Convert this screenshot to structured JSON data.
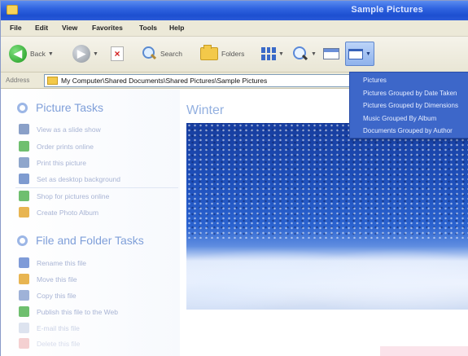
{
  "window": {
    "title": "Sample Pictures"
  },
  "menu": {
    "items": [
      "File",
      "Edit",
      "View",
      "Favorites",
      "Tools",
      "Help"
    ]
  },
  "toolbar": {
    "back_label": "Back",
    "search_label": "Search",
    "folders_label": "Folders"
  },
  "address": {
    "label": "Address",
    "path": "My Computer\\Shared Documents\\Shared Pictures\\Sample Pictures"
  },
  "picture_tasks": {
    "heading": "Picture Tasks",
    "items": [
      {
        "label": "View as a slide show",
        "icon": "slideshow-icon",
        "color": "#8aa0c8"
      },
      {
        "label": "Order prints online",
        "icon": "globe-icon",
        "color": "#6fbf6f"
      },
      {
        "label": "Print this picture",
        "icon": "printer-icon",
        "color": "#8fa6cc"
      },
      {
        "label": "Set as desktop background",
        "icon": "desktop-icon",
        "color": "#7e9bd0"
      },
      {
        "label": "Shop for pictures online",
        "icon": "globe-icon",
        "color": "#6fbf6f"
      },
      {
        "label": "Create Photo Album",
        "icon": "album-icon",
        "color": "#e8b552"
      }
    ]
  },
  "file_tasks": {
    "heading": "File and Folder Tasks",
    "items": [
      {
        "label": "Rename this file",
        "icon": "rename-icon",
        "color": "#7f9bd8"
      },
      {
        "label": "Move this file",
        "icon": "move-icon",
        "color": "#e8b552"
      },
      {
        "label": "Copy this file",
        "icon": "copy-icon",
        "color": "#9fb2d8"
      },
      {
        "label": "Publish this file to the Web",
        "icon": "publish-icon",
        "color": "#6fbf6f"
      },
      {
        "label": "E-mail this file",
        "icon": "email-icon",
        "color": "#c8d2e6"
      },
      {
        "label": "Delete this file",
        "icon": "delete-icon",
        "color": "#e89a9a"
      }
    ]
  },
  "main": {
    "folder_title": "Winter"
  },
  "view_dropdown": {
    "items": [
      "Pictures",
      "Pictures Grouped by Date Taken",
      "Pictures Grouped by Dimensions",
      "Music Grouped By Album",
      "Documents Grouped by Author"
    ]
  },
  "colors": {
    "titlebar": "#2f63e0",
    "accent": "#3d67c9",
    "task_text": "#a8b4d4"
  }
}
